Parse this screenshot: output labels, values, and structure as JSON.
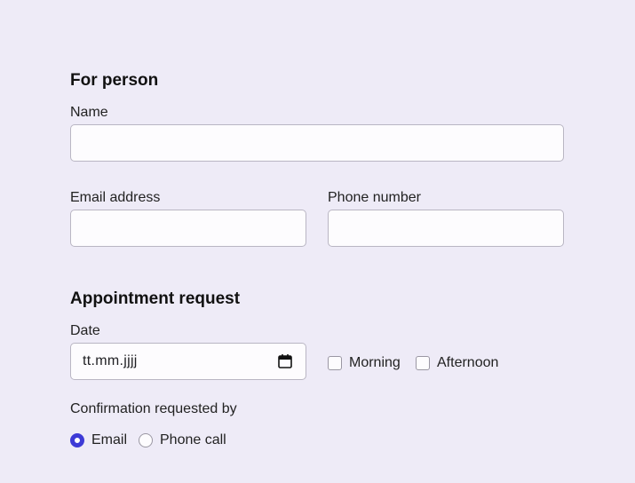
{
  "person": {
    "heading": "For person",
    "name_label": "Name",
    "name_value": "",
    "email_label": "Email address",
    "email_value": "",
    "phone_label": "Phone number",
    "phone_value": ""
  },
  "appointment": {
    "heading": "Appointment request",
    "date_label": "Date",
    "date_placeholder": "tt.mm.jjjj",
    "morning_label": "Morning",
    "morning_checked": false,
    "afternoon_label": "Afternoon",
    "afternoon_checked": false,
    "confirmation_label": "Confirmation requested by",
    "email_option": "Email",
    "phone_option": "Phone call",
    "selected_option": "Email"
  },
  "colors": {
    "background": "#eeebf7",
    "accent": "#3d3ad6"
  }
}
